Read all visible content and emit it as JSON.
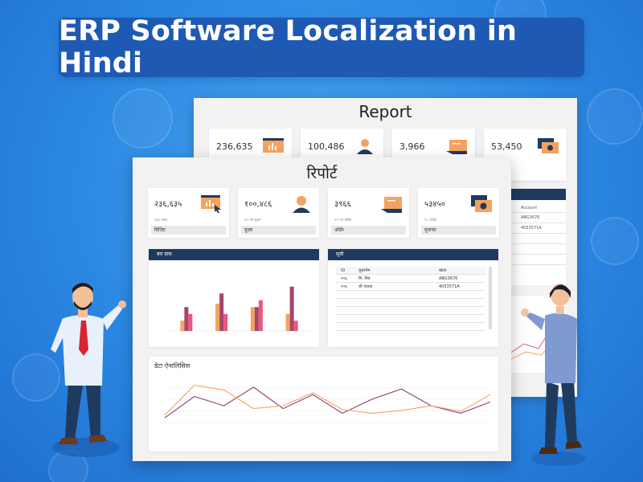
{
  "banner": {
    "title": "ERP Software Localization in Hindi"
  },
  "back_report": {
    "title": "Report",
    "cards": [
      {
        "value": "236,635"
      },
      {
        "value": "100,486"
      },
      {
        "value": "3,966"
      },
      {
        "value": "53,450"
      }
    ],
    "side_table": {
      "cells": [
        "Account",
        "ABG3676",
        "4053571A"
      ]
    }
  },
  "hindi_report": {
    "title": "रिपोर्ट",
    "cards": [
      {
        "value": "२३६,६३५",
        "sub": "२७० आज",
        "label": "विजिट"
      },
      {
        "value": "१००,४८६",
        "sub": "२० नए यूजर",
        "label": "यूज़र"
      },
      {
        "value": "३९६६",
        "sub": "१२ नए ऑर्डर",
        "label": "ऑर्डर"
      },
      {
        "value": "५३४५०",
        "sub": "२८ ऑर्डर",
        "label": "मुनाफा"
      }
    ],
    "bar_panel_title": "बार ग्राफ़",
    "sales_panel_title": "सूची",
    "sales_table": {
      "headers": [
        "ID",
        "यूज़रनेम",
        "खाता"
      ],
      "rows": [
        [
          "२१६",
          "मि. मित्र",
          "ABG3676"
        ],
        [
          "२२६",
          "श्री पाठक",
          "4053571A"
        ]
      ]
    },
    "trend_title": "डेटा ऐनालिसिस"
  },
  "chart_data": [
    {
      "type": "bar",
      "categories": [
        "",
        "",
        "",
        ""
      ],
      "series": [
        {
          "values": [
            15,
            40,
            35,
            25
          ]
        },
        {
          "values": [
            35,
            55,
            35,
            65
          ]
        },
        {
          "values": [
            25,
            25,
            45,
            15
          ]
        }
      ],
      "ylim": [
        0,
        80
      ],
      "colors": [
        "#f4a35f",
        "#a6456b",
        "#e9587a"
      ]
    },
    {
      "type": "line",
      "x": [
        0,
        1,
        2,
        3,
        4,
        5,
        6,
        7,
        8,
        9,
        10,
        11
      ],
      "series": [
        {
          "values": [
            5,
            28,
            18,
            38,
            15,
            30,
            10,
            25,
            36,
            18,
            10,
            22
          ]
        },
        {
          "values": [
            8,
            40,
            35,
            15,
            18,
            32,
            14,
            10,
            13,
            18,
            12,
            30
          ]
        }
      ],
      "ylim": [
        0,
        50
      ],
      "colors": [
        "#8a3f73",
        "#f4a35f"
      ]
    }
  ],
  "colors": {
    "background": "#2b88e2",
    "banner": "#1e5ab4",
    "panel_header": "#1f3a5f",
    "accent_orange": "#f4a35f",
    "navy": "#1f3a5f"
  }
}
